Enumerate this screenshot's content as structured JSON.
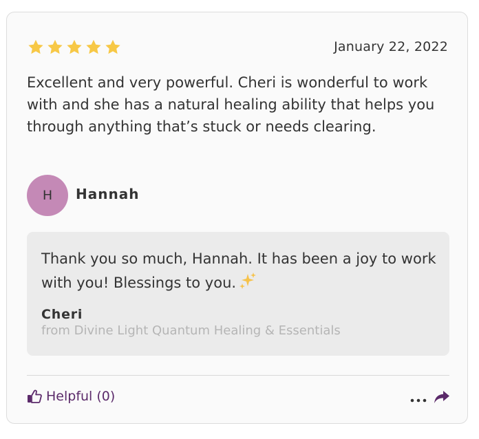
{
  "review": {
    "rating": 5,
    "max_rating": 5,
    "date": "January 22, 2022",
    "text": "Excellent and very powerful. Cheri is wonderful to work with and she has a natural healing ability that helps you through anything that’s stuck or needs clearing.",
    "author": {
      "initial": "H",
      "name": "Hannah",
      "avatar_color": "#c489b6"
    }
  },
  "reply": {
    "text": "Thank you so much, Hannah. It has been a joy to work with you! Blessings to you.",
    "emoji_icon": "sparkles-icon",
    "author": "Cheri",
    "from": "from Divine Light Quantum Healing & Essentials"
  },
  "footer": {
    "helpful_label": "Helpful (0)",
    "helpful_icon": "thumbs-up-icon",
    "more_icon": "more-dots-icon",
    "share_icon": "share-arrow-icon"
  },
  "colors": {
    "star": "#f7c846",
    "accent": "#5b2a6a",
    "reply_bg": "#ebebeb",
    "card_bg": "#fafafa"
  }
}
